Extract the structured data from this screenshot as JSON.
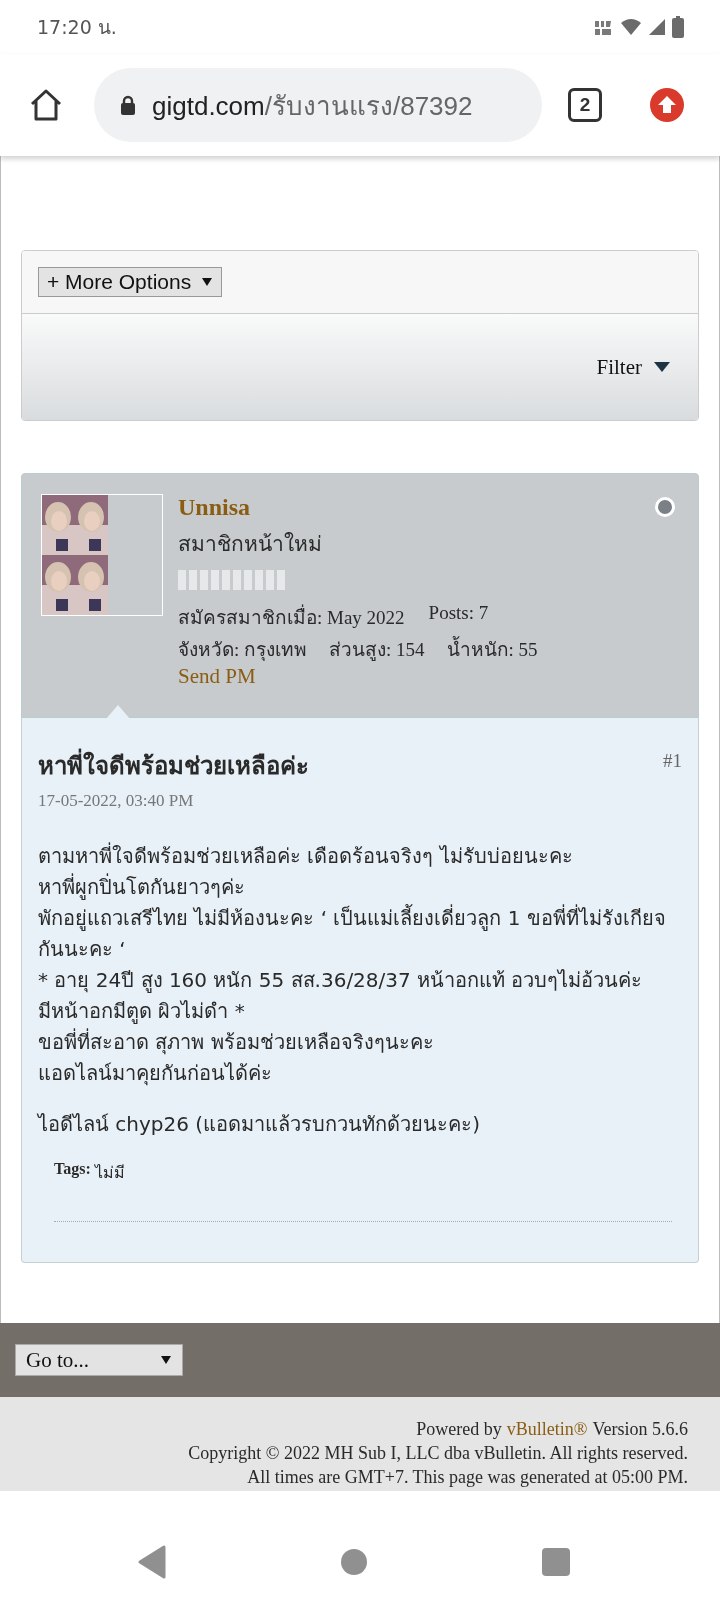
{
  "status_bar": {
    "time": "17:20 น."
  },
  "browser": {
    "url_host": "gigtd.com",
    "url_path": "/รับงานแรง/87392",
    "tab_count": "2"
  },
  "toolbar": {
    "more_options": "+ More Options",
    "filter": "Filter"
  },
  "post": {
    "author": {
      "name": "Unnisa",
      "avatar": {
        "kind": "picture"
      },
      "rank": "สมาชิกหน้าใหม่",
      "online": false,
      "stats": [
        [
          "สมัครสมาชิกเมื่อ: May 2022",
          "Posts: 7"
        ],
        [
          "จังหวัด: กรุงเทพ",
          "ส่วนสูง: 154",
          "น้ำหนัก: 55"
        ]
      ],
      "send_pm": "Send PM"
    },
    "title": "หาพี่ใจดีพร้อมช่วยเหลือค่ะ",
    "number": "#1",
    "date": "17-05-2022, 03:40 PM",
    "body": [
      [
        "ตามหาพี่ใจดีพร้อมช่วยเหลือค่ะ เดือดร้อนจริงๆ ไม่รับบ่อยนะคะ",
        "หาพี่ผูกปิ่นโตกันยาวๆค่ะ",
        "พักอยู่แถวเสรีไทย ไม่มีห้องนะคะ ‘ เป็นแม่เลี้ยงเดี่ยวลูก 1 ขอพี่ที่ไม่รังเกียจกันนะคะ ‘",
        "* อายุ 24ปี สูง 160 หนัก 55 สส.36/28/37 หน้าอกแท้ อวบๆไม่อ้วนค่ะ มีหน้าอกมีตูด ผิวไม่ดำ *",
        "ขอพี่ที่สะอาด สุภาพ พร้อมช่วยเหลือจริงๆนะคะ",
        "แอดไลน์มาคุยกันก่อนได้ค่ะ"
      ],
      [
        "ไอดีไลน์ chyp26 (แอดมาแล้วรบกวนทักด้วยนะคะ)"
      ]
    ],
    "tags_label": "Tags:",
    "tags": "ไม่มี"
  },
  "footer": {
    "goto": "Go to...",
    "powered_by": "Powered by",
    "vbulletin_link": "vBulletin®",
    "version": "Version 5.6.6",
    "copyright": "Copyright © 2022 MH Sub I, LLC dba vBulletin. All rights reserved.",
    "times": "All times are GMT+7. This page was generated at 05:00 PM."
  }
}
